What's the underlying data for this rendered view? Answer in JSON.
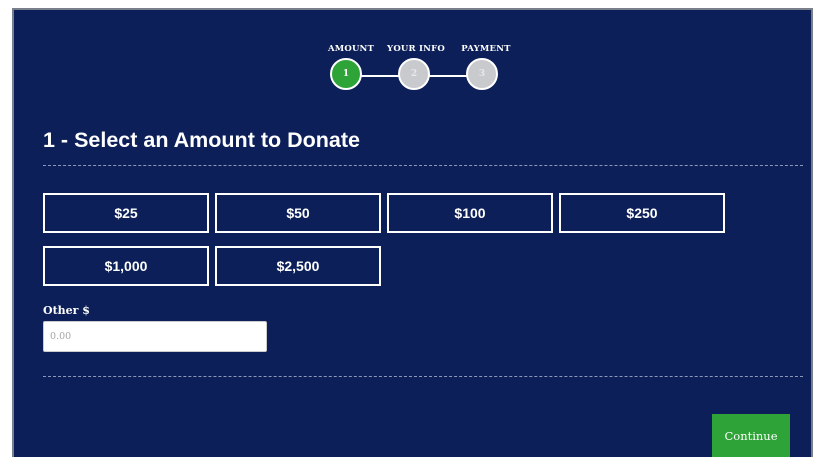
{
  "progress": {
    "steps": [
      {
        "label": "AMOUNT",
        "number": "1",
        "status": "active"
      },
      {
        "label": "YOUR INFO",
        "number": "2",
        "status": "inactive"
      },
      {
        "label": "PAYMENT",
        "number": "3",
        "status": "inactive"
      }
    ]
  },
  "section": {
    "title": "1 - Select an Amount to Donate"
  },
  "amounts": [
    "$25",
    "$50",
    "$100",
    "$250",
    "$1,000",
    "$2,500"
  ],
  "other": {
    "label": "Other $",
    "placeholder": "0.00",
    "value": ""
  },
  "actions": {
    "continue_label": "Continue"
  },
  "colors": {
    "background": "#0c1f58",
    "accent_green": "#2ea337",
    "inactive_step": "#c9cacd",
    "text": "#ffffff"
  }
}
